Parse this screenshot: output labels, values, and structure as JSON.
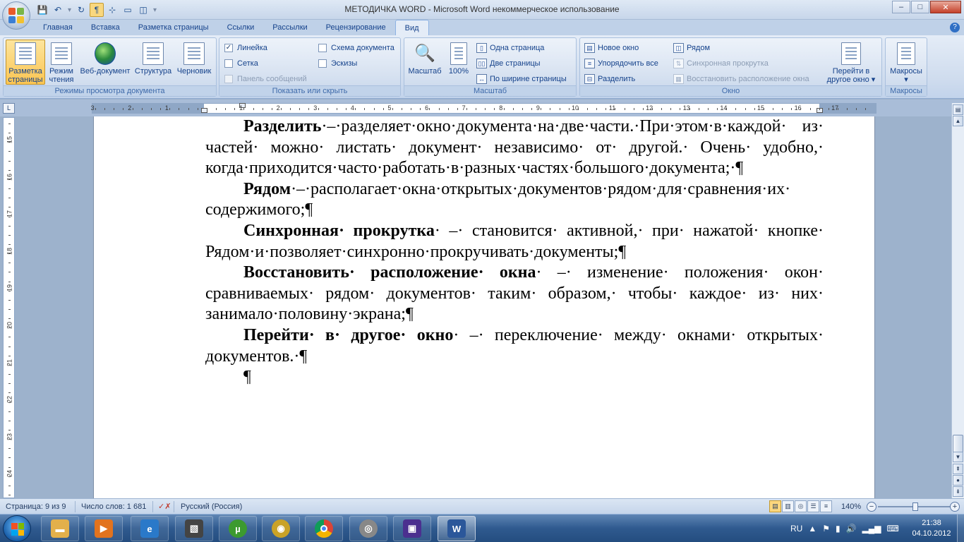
{
  "window": {
    "title": "МЕТОДИЧКА WORD - Microsoft Word некоммерческое использование",
    "controls": {
      "minimize": "–",
      "maximize": "□",
      "close": "✕"
    }
  },
  "qat": {
    "save_icon": "💾",
    "undo_icon": "↶",
    "redo_icon": "↻",
    "pilcrow": "¶",
    "customize": "▾"
  },
  "tabs": [
    "Главная",
    "Вставка",
    "Разметка страницы",
    "Ссылки",
    "Рассылки",
    "Рецензирование",
    "Вид"
  ],
  "active_tab": "Вид",
  "ribbon": {
    "views": {
      "label": "Режимы просмотра документа",
      "buttons": [
        {
          "line1": "Разметка",
          "line2": "страницы"
        },
        {
          "line1": "Режим",
          "line2": "чтения"
        },
        {
          "line1": "Веб-документ",
          "line2": ""
        },
        {
          "line1": "Структура",
          "line2": ""
        },
        {
          "line1": "Черновик",
          "line2": ""
        }
      ]
    },
    "show": {
      "label": "Показать или скрыть",
      "ruler": "Линейка",
      "grid": "Сетка",
      "messages": "Панель сообщений",
      "docmap": "Схема документа",
      "thumbs": "Эскизы"
    },
    "zoom": {
      "label": "Масштаб",
      "zoom_btn": "Масштаб",
      "hundred": "100%",
      "one_page": "Одна страница",
      "two_pages": "Две страницы",
      "page_width": "По ширине страницы"
    },
    "window": {
      "label": "Окно",
      "new_window": "Новое окно",
      "arrange_all": "Упорядочить все",
      "split": "Разделить",
      "side_by_side": "Рядом",
      "sync_scroll": "Синхронная прокрутка",
      "reset_pos": "Восстановить расположение окна",
      "switch_line1": "Перейти в",
      "switch_line2": "другое окно ▾"
    },
    "macros": {
      "label": "Макросы",
      "btn": "Макросы"
    }
  },
  "ruler": {
    "corner": "L",
    "hticks": [
      "3",
      "2",
      "1",
      "1",
      "2",
      "3",
      "4",
      "5",
      "6",
      "7",
      "8",
      "9",
      "10",
      "11",
      "12",
      "13",
      "14",
      "15",
      "16",
      "17"
    ],
    "vticks": [
      "15",
      "16",
      "17",
      "18",
      "19",
      "20",
      "21",
      "22",
      "23",
      "24"
    ]
  },
  "document": {
    "paragraphs": [
      {
        "bold": "Разделить",
        "text": "·–·разделяет·окно·документа·на·две·части.·При·этом·в·каждой· из· частей· можно· листать· документ· независимо· от· другой.· Очень· удобно,· когда·приходится·часто·работать·в·разных·частях·большого·документа;·¶"
      },
      {
        "bold": "Рядом",
        "text": "·–·располагает·окна·открытых·документов·рядом·для·сравнения·их· содержимого;¶"
      },
      {
        "bold": "Синхронная· прокрутка",
        "text": "· –· становится· активной,· при· нажатой· кнопке· Рядом·и·позволяет·синхронно·прокручивать·документы;¶"
      },
      {
        "bold": "Восстановить· расположение· окна",
        "text": "· –· изменение· положения· окон· сравниваемых· рядом· документов· таким· образом,· чтобы· каждое· из· них· занимало·половину·экрана;¶"
      },
      {
        "bold": "Перейти· в· другое· окно",
        "text": "· –· переключение· между· окнами· открытых· документов.·¶"
      },
      {
        "bold": "",
        "text": "¶"
      }
    ]
  },
  "status": {
    "page": "Страница: 9 из 9",
    "words": "Число слов: 1 681",
    "language": "Русский (Россия)",
    "zoom": "140%",
    "zoom_minus": "−",
    "zoom_plus": "+"
  },
  "taskbar": {
    "lang": "RU",
    "time": "21:38",
    "date": "04.10.2012"
  },
  "colors": {
    "accent": "#15428b",
    "ribbon": "#cfdcee",
    "taskbar": "#2f5a8f"
  }
}
